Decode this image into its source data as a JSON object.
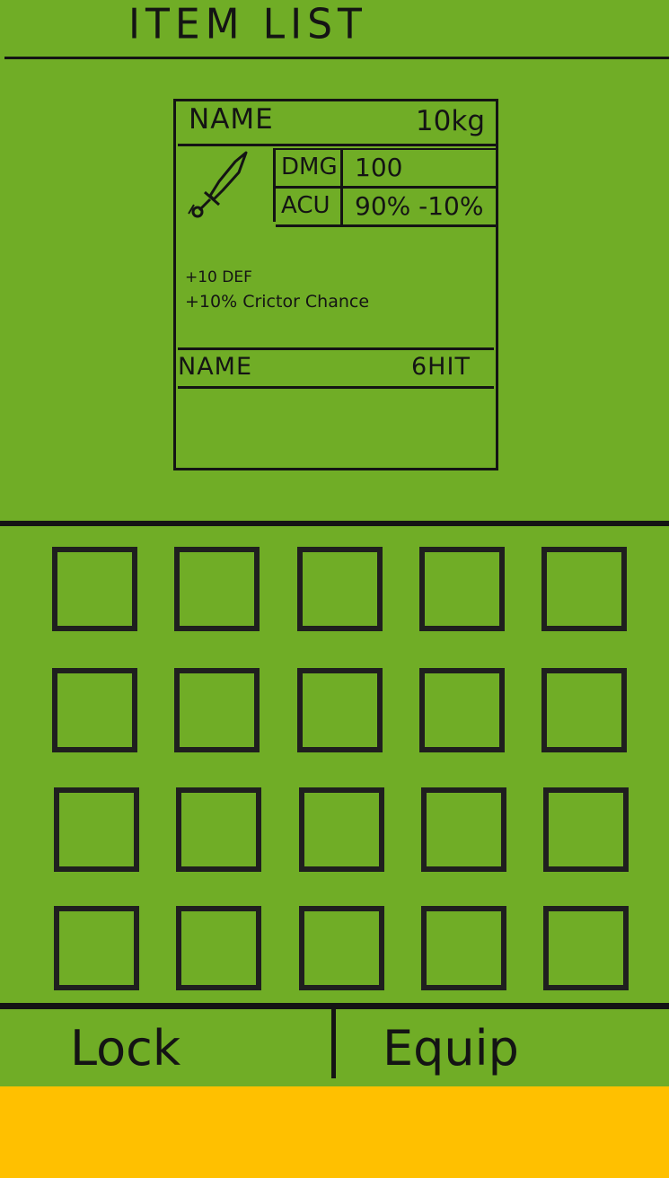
{
  "header": {
    "title": "ITEM LIST"
  },
  "item_card": {
    "name": "NAME",
    "weight": "10kg",
    "icon": "sword-icon",
    "stats": [
      {
        "label": "DMG",
        "value": "100"
      },
      {
        "label": "ACU",
        "value": "90% -10%"
      }
    ],
    "bonuses": [
      "+10 DEF",
      "+10% Crictor Chance"
    ],
    "secondary_name": "NAME",
    "secondary_value": "6HIT"
  },
  "inventory": {
    "rows": 4,
    "columns": 5,
    "slots_filled": 0
  },
  "actions": {
    "lock_label": "Lock",
    "equip_label": "Equip"
  },
  "colors": {
    "background": "#70AD26",
    "footer": "#FFC000",
    "ink": "#141414"
  }
}
